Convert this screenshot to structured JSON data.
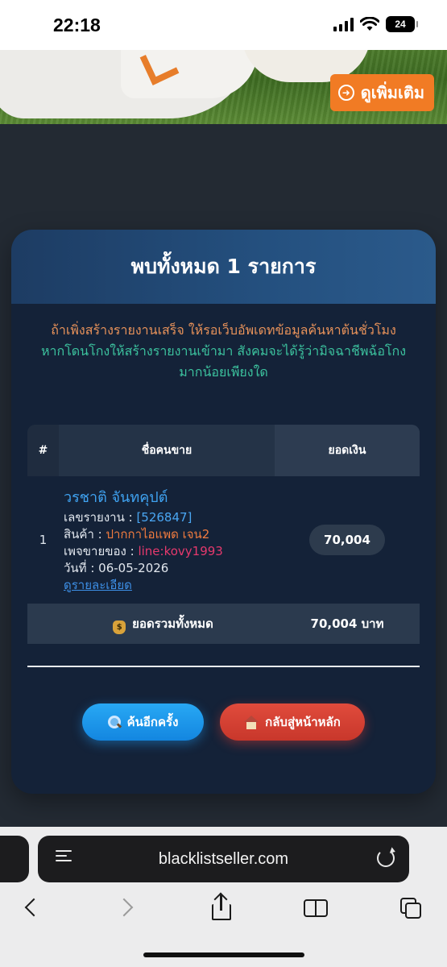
{
  "status_bar": {
    "time": "22:18",
    "battery": "24"
  },
  "banner": {
    "button_label": "ดูเพิ่มเติม",
    "button_icon": "circle-arrow-icon"
  },
  "result": {
    "title": "พบทั้งหมด 1 รายการ",
    "notice_line1": "ถ้าเพิ่งสร้างรายงานเสร็จ ให้รอเว็บอัพเดทข้อมูลค้นหาต้นชั่วโมง",
    "notice_line2a": "หากโดนโกงให้สร้างรายงานเข้ามา สังคมจะได้รู้ว่ามิจฉาชีพฉ้อโกง",
    "notice_line2b": "มากน้อยเพียงใด",
    "columns": [
      "#",
      "ชื่อคนขาย",
      "ยอดเงิน"
    ],
    "rows": [
      {
        "num": "1",
        "seller_name": "วรชาติ จันทคุปต์",
        "report_label": "เลขรายงาน : ",
        "report_no": "[526847]",
        "product_label": "สินค้า : ",
        "product": "ปากกาไอแพด เจน2",
        "page_label": "เพจขายของ : ",
        "page": "line:kovy1993",
        "date_label": "วันที่ : ",
        "date": "06-05-2026",
        "details_link": "ดูรายละเอียด",
        "amount": "70,004"
      }
    ],
    "total_label": "ยอดรวมทั้งหมด",
    "total_amount": "70,004 บาท",
    "search_again": "ค้นอีกครั้ง",
    "back_home": "กลับสู่หน้าหลัก"
  },
  "browser": {
    "url": "blacklistseller.com"
  },
  "colors": {
    "accent_blue": "#3fa2f0",
    "notice_orange": "#e8925a",
    "notice_green": "#3cc29e",
    "product_orange": "#f07b3f",
    "page_pink": "#e5396d",
    "search_button": "#1e96f0",
    "home_button": "#d8402f",
    "banner_button": "#f17b24"
  }
}
